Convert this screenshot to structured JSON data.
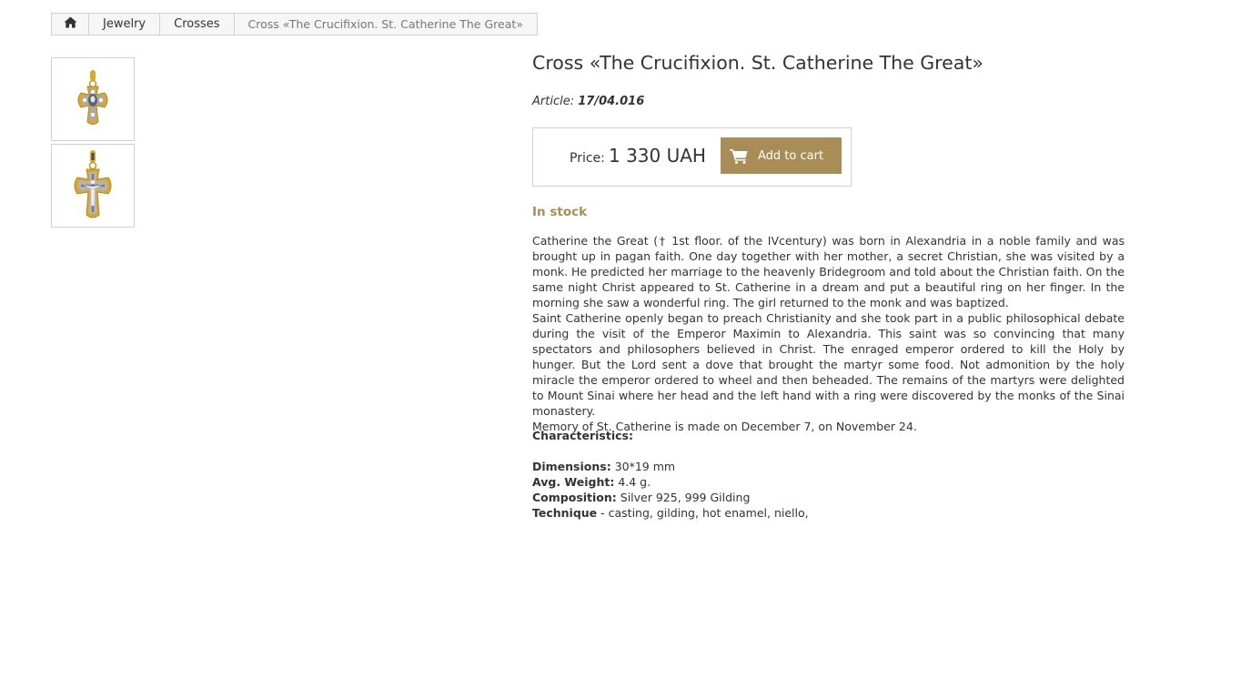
{
  "breadcrumb": {
    "home_icon": "home-icon",
    "items": [
      "Jewelry",
      "Crosses"
    ],
    "current": "Cross «The Crucifixion. St. Catherine The Great»"
  },
  "thumbnails": [
    {
      "icon": "cross-pendant-front-icon"
    },
    {
      "icon": "cross-pendant-crucifix-icon"
    }
  ],
  "product": {
    "title": "Cross «The Crucifixion. St. Catherine The Great»",
    "article_label": "Article:",
    "article_value": "17/04.016",
    "price_label": "Price:",
    "price_value": "1 330 UAH",
    "cart_button": "Add to cart",
    "stock_status": "In stock"
  },
  "description": {
    "paragraphs": [
      "Catherine the Great († 1st floor. of the IVcentury) was born in Alexandria in a noble family and was brought up in pagan faith. One day together with her mother, a secret Christian, she was visited by a monk. He predicted her marriage to the heavenly Bridegroom and told about the Christian faith. On the same night Christ appeared to St. Catherine in a dream and put a beautiful ring on her finger. In the morning she saw a wonderful ring. The girl returned to the monk and was baptized.",
      "Saint Catherine openly began to preach Christianity and she took part in a public philosophical debate during the visit of the Emperor Maximin to Alexandria. This saint was so convincing that many spectators and philosophers believed in Christ. The enraged emperor ordered to kill the Holy by hunger. But the Lord sent a dove that brought the martyr some food. Not admonition by the holy miracle the emperor ordered to wheel and then beheaded. The remains of the martyrs were delighted to Mount Sinai where her head and the left hand with a ring were discovered by the monks of the Sinai monastery.",
      "Memory of St. Catherine is made on December 7, on November 24."
    ]
  },
  "characteristics": {
    "heading": "Characteristics:",
    "rows": [
      {
        "label": "Dimensions:",
        "value": " 30*19 mm"
      },
      {
        "label": "Avg. Weight:",
        "value": " 4.4 g."
      },
      {
        "label": "Composition:",
        "value": " Silver 925, 999 Gilding"
      },
      {
        "label": "Technique",
        "value": " - casting, gilding, hot enamel, niello,"
      }
    ]
  },
  "colors": {
    "accent": "#a98d56",
    "border": "#d0d0d0",
    "text": "#333333"
  }
}
